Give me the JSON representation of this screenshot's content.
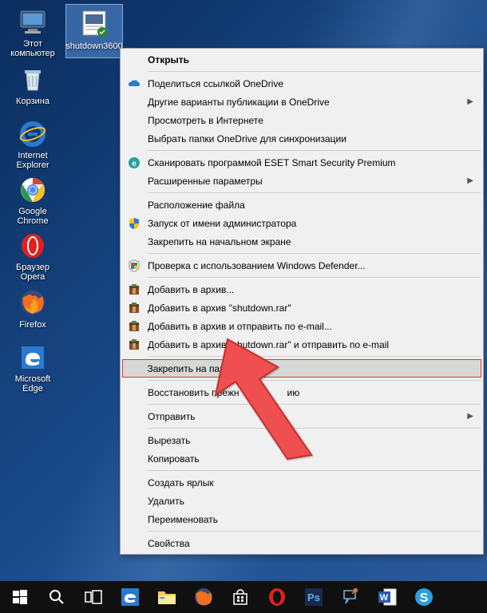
{
  "desktop_icons": {
    "this_pc": "Этот компьютер",
    "shutdown": "shutdown3600",
    "recycle": "Корзина",
    "ie": "Internet Explorer",
    "chrome": "Google Chrome",
    "opera": "Браузер Opera",
    "firefox": "Firefox",
    "edge": "Microsoft Edge"
  },
  "context_menu": {
    "open": "Открыть",
    "onedrive_share": "Поделиться ссылкой OneDrive",
    "onedrive_other": "Другие варианты публикации в OneDrive",
    "view_internet": "Просмотреть в Интернете",
    "onedrive_sync": "Выбрать папки OneDrive для синхронизации",
    "eset_scan": "Сканировать программой ESET Smart Security Premium",
    "eset_advanced": "Расширенные параметры",
    "file_location": "Расположение файла",
    "run_admin": "Запуск от имени администратора",
    "pin_start": "Закрепить на начальном экране",
    "defender": "Проверка с использованием Windows Defender...",
    "add_archive": "Добавить в архив...",
    "add_rar": "Добавить в архив \"shutdown.rar\"",
    "add_email": "Добавить в архив и отправить по e-mail...",
    "add_rar_email": "Добавить в архив \"shutdown.rar\" и отправить по e-mail",
    "pin_taskbar": "Закрепить на панели задач",
    "restore_prev": "Восстановить прежн",
    "restore_prev_suffix": "ию",
    "send_to": "Отправить",
    "cut": "Вырезать",
    "copy": "Копировать",
    "create_shortcut": "Создать ярлык",
    "delete": "Удалить",
    "rename": "Переименовать",
    "properties": "Свойства"
  }
}
